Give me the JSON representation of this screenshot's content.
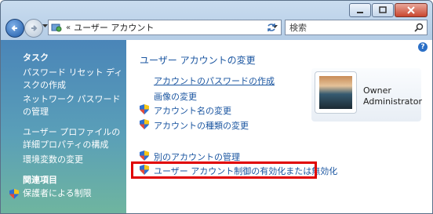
{
  "window": {
    "title_buttons": {
      "minimize": "minimize",
      "maximize": "maximize",
      "close": "close"
    }
  },
  "navbar": {
    "address_separator": "«",
    "address_crumb": "ユーザー アカウント",
    "search_placeholder": "検索"
  },
  "sidebar": {
    "tasks_heading": "タスク",
    "tasks": [
      "パスワード リセット ディスクの作成",
      "ネットワーク パスワードの管理",
      "ユーザー プロファイルの詳細プロパティの構成",
      "環境変数の変更"
    ],
    "related_heading": "関連項目",
    "related": [
      "保護者による制限"
    ]
  },
  "main": {
    "title": "ユーザー アカウントの変更",
    "links": [
      "アカウントのパスワードの作成",
      "画像の変更",
      "アカウント名の変更",
      "アカウントの種類の変更",
      "別のアカウントの管理",
      "ユーザー アカウント制御の有効化または無効化"
    ],
    "help": "?"
  },
  "user": {
    "name": "Owner",
    "role": "Administrator"
  },
  "colors": {
    "link": "#1a55a0",
    "highlight": "#e00000",
    "sidebar_top": "#4a85b8",
    "sidebar_bottom": "#6fb59f"
  }
}
